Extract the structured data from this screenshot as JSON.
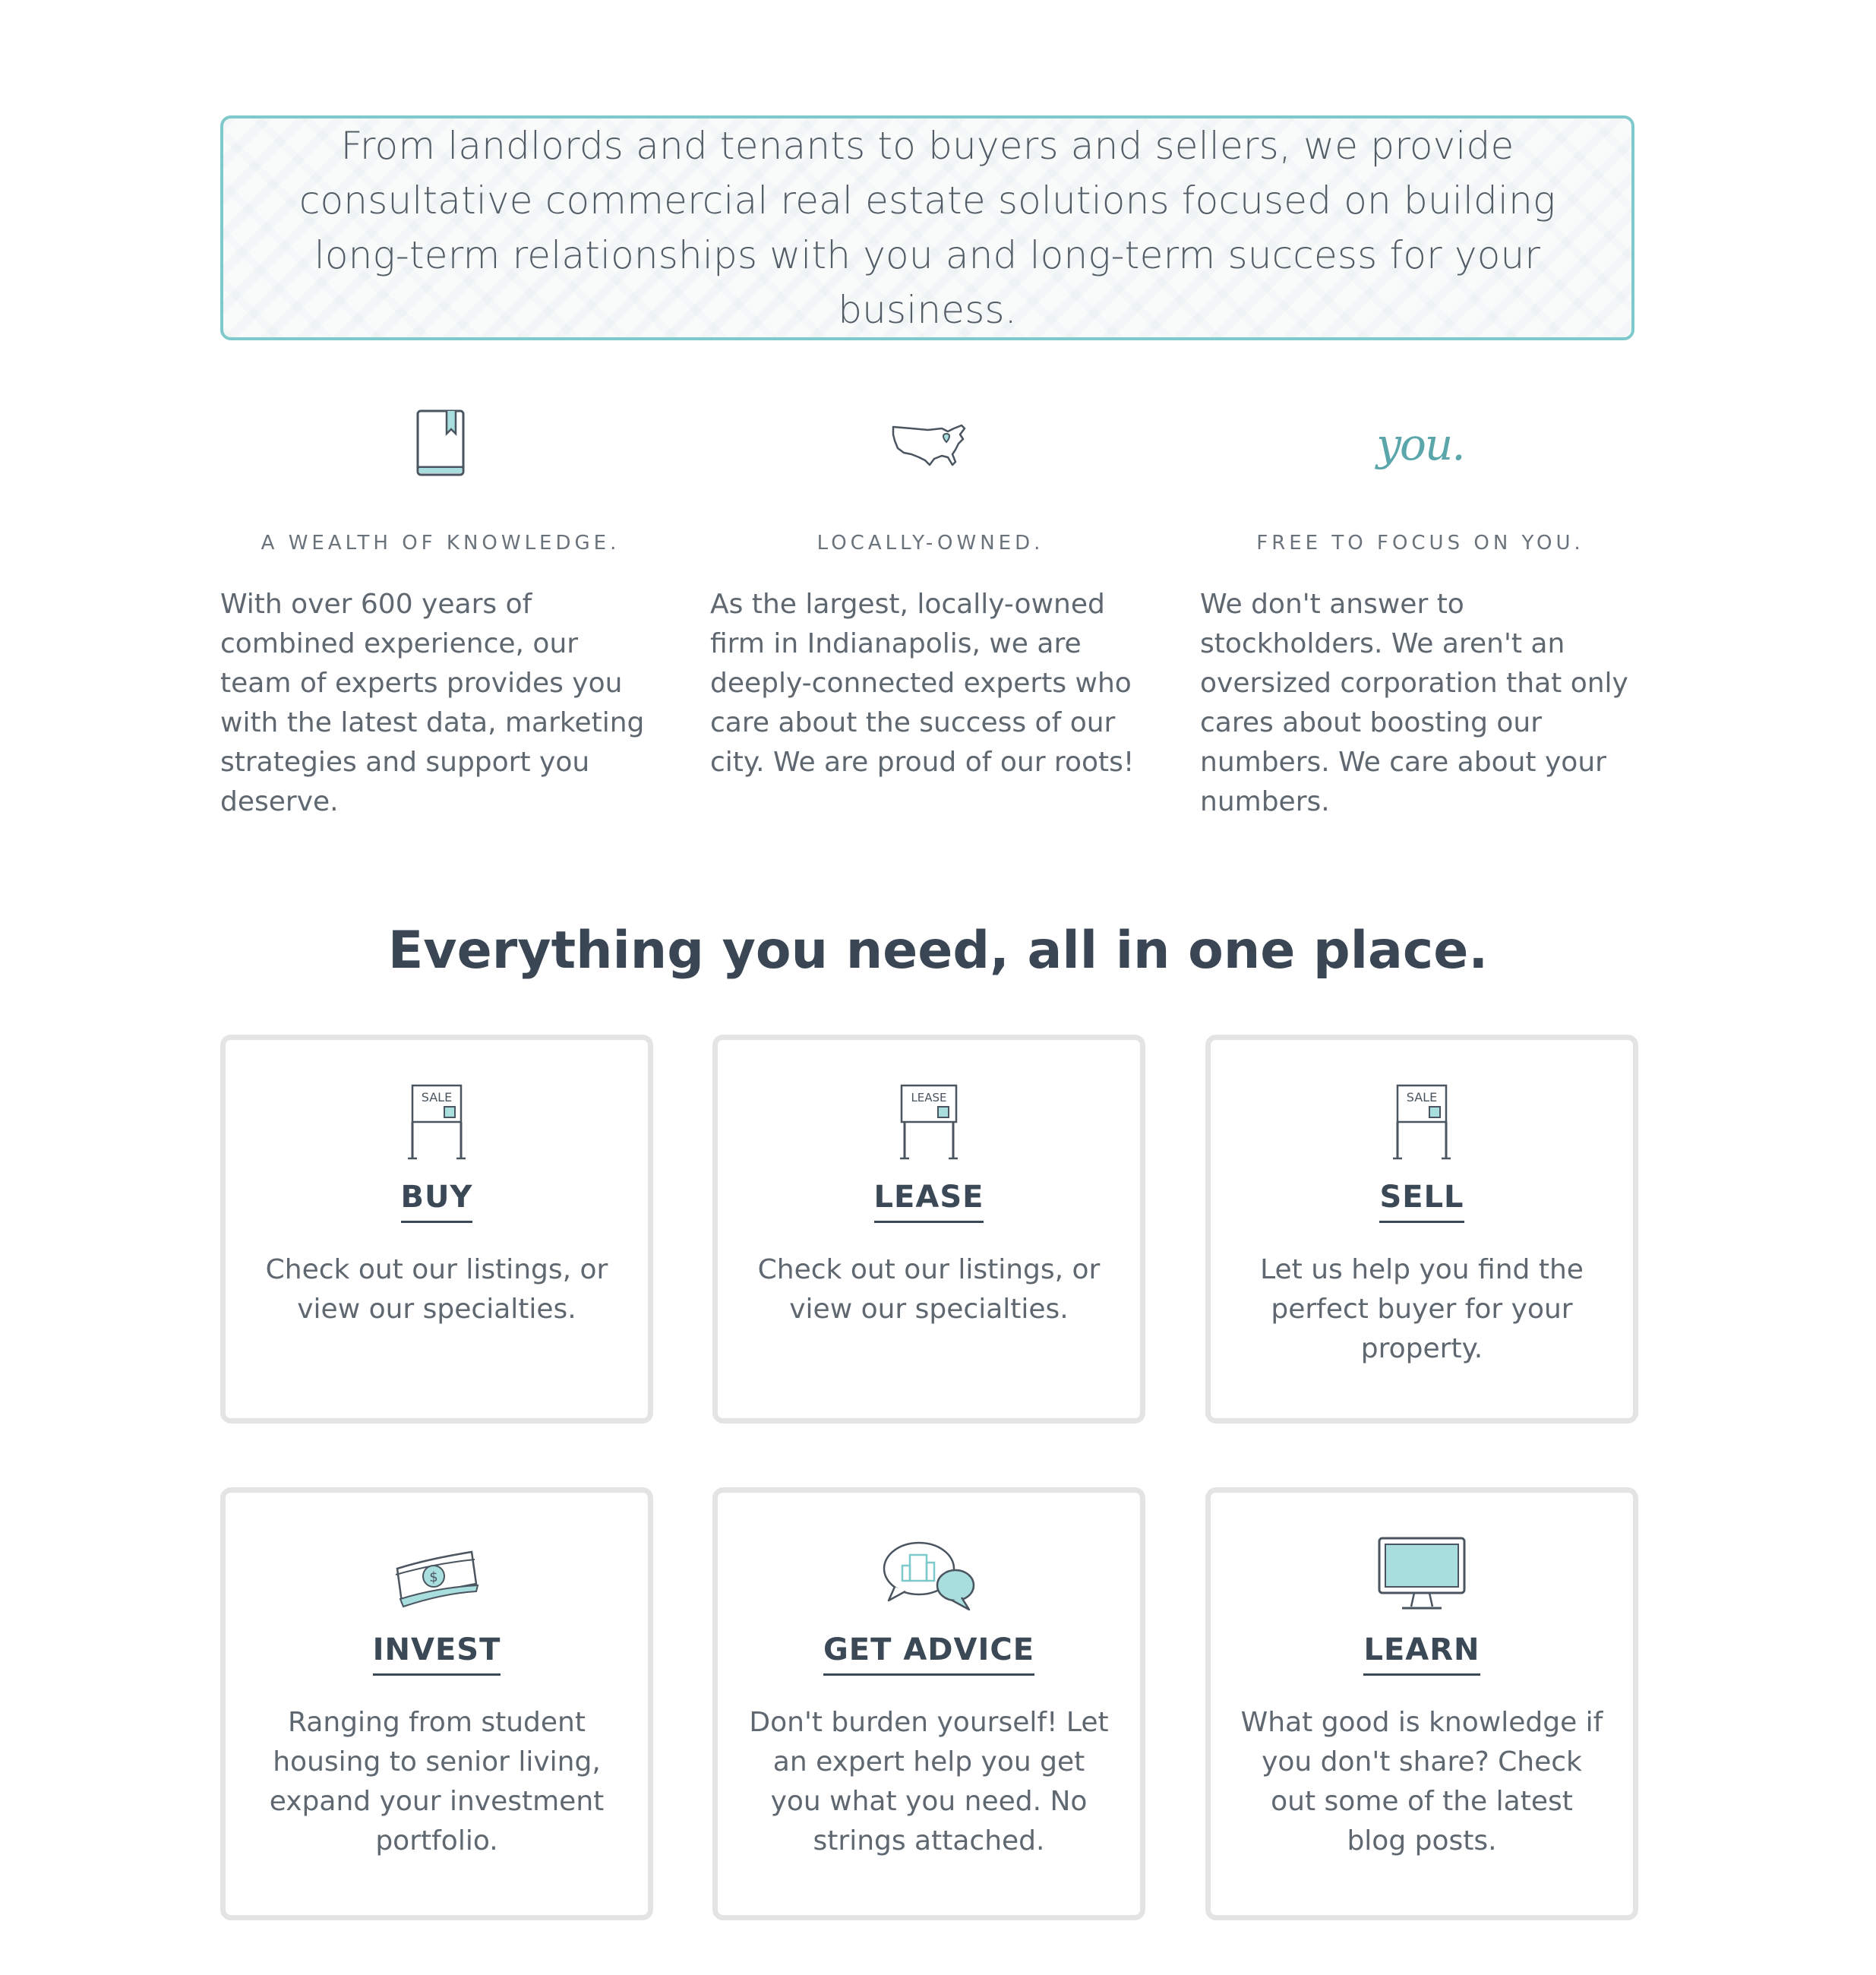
{
  "intro": {
    "text": "From landlords and tenants to buyers and sellers, we provide consultative commercial real estate solutions focused on building long-term relationships with you and long-term success for your business."
  },
  "features": [
    {
      "icon": "book-icon",
      "title": "A WEALTH OF KNOWLEDGE.",
      "body": "With over 600 years of combined experience, our team of experts provides you with the latest data, marketing strategies and support you deserve."
    },
    {
      "icon": "usa-map-icon",
      "title": "LOCALLY-OWNED.",
      "body": "As the largest, locally-owned firm in Indianapolis, we are deeply-connected experts who care about the success of our city. We are proud of our roots!"
    },
    {
      "icon": "you-script-icon",
      "icon_text": "you.",
      "title": "FREE TO FOCUS ON YOU.",
      "body": "We don't answer to stockholders. We aren't an oversized corporation that only cares about boosting our numbers. We care about your numbers."
    }
  ],
  "services": {
    "heading": "Everything you need, all in one place.",
    "cards": [
      {
        "icon": "sale-sign-icon",
        "sign_text": "SALE",
        "title": "BUY",
        "body": "Check out our listings, or view our specialties."
      },
      {
        "icon": "lease-sign-icon",
        "sign_text": "LEASE",
        "title": "LEASE",
        "body": "Check out our listings, or view our specialties."
      },
      {
        "icon": "sale-sign-icon",
        "sign_text": "SALE",
        "title": "SELL",
        "body": "Let us help you find the perfect buyer for your property."
      },
      {
        "icon": "money-icon",
        "title": "INVEST",
        "body": "Ranging from student housing to senior living, expand your investment portfolio."
      },
      {
        "icon": "chat-bubbles-icon",
        "title": "GET ADVICE",
        "body": "Don't burden yourself! Let an expert help you get you what you need. No strings attached."
      },
      {
        "icon": "monitor-icon",
        "title": "LEARN",
        "body": "What good is knowledge if you don't share? Check out some of the latest blog posts."
      }
    ]
  },
  "colors": {
    "accent": "#7dc9cb",
    "accent_fill": "#a8dedd",
    "heading": "#3a4654",
    "text": "#5f6870",
    "card_border": "#e4e4e4"
  }
}
